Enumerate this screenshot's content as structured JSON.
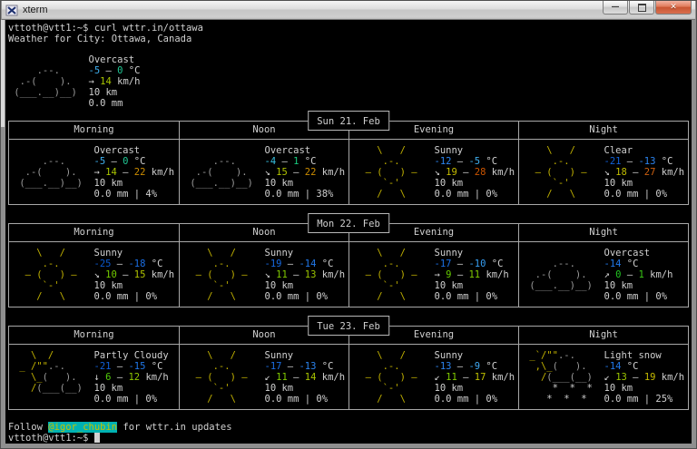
{
  "window": {
    "title": "xterm",
    "controls": {
      "minimize": "minimize-icon",
      "maximize": "maximize-icon",
      "close": "close-icon"
    }
  },
  "colors": {
    "fg": "#d0d0d0",
    "y": "#c2b200",
    "c": "#9a9a9a",
    "w": "#d0d0d0",
    "border": "#a8a8a8",
    "handle_bg": "#00b2b2",
    "handle_fg": "#c3c300"
  },
  "terminal": {
    "command_line": "vttoth@vtt1:~$ curl wttr.in/ottawa",
    "location_line": "Weather for City: Ottawa, Canada",
    "footer_prefix": "Follow ",
    "footer_handle": "@igor_chubin",
    "footer_suffix": " for wttr.in updates",
    "prompt": "vttoth@vtt1:~$ "
  },
  "current": {
    "condition": "Overcast",
    "icon": "overcast",
    "temp": [
      {
        "t": "-5",
        "c": "#3fb0f0"
      },
      {
        "t": " – "
      },
      {
        "t": "0",
        "c": "#20c895"
      },
      {
        "t": " °C"
      }
    ],
    "wind": [
      {
        "t": "→ "
      },
      {
        "t": "14",
        "c": "#a8c400"
      },
      {
        "t": " km/h"
      }
    ],
    "visibility": "10 km",
    "precip": "0.0 mm"
  },
  "days": [
    {
      "date": "Sun 21. Feb",
      "periods": [
        {
          "label": "Morning",
          "icon": "overcast",
          "condition": "Overcast",
          "temp": [
            {
              "t": "-5",
              "c": "#3fb0f0"
            },
            {
              "t": " – "
            },
            {
              "t": "0",
              "c": "#20c895"
            },
            {
              "t": " °C"
            }
          ],
          "wind": [
            {
              "t": "→ "
            },
            {
              "t": "14",
              "c": "#a8c400"
            },
            {
              "t": " – "
            },
            {
              "t": "22",
              "c": "#cc8c00"
            },
            {
              "t": " km/h"
            }
          ],
          "visibility": "10 km",
          "precip": "0.0 mm | 4%"
        },
        {
          "label": "Noon",
          "icon": "overcast",
          "condition": "Overcast",
          "temp": [
            {
              "t": "-4",
              "c": "#38c0e0"
            },
            {
              "t": " – "
            },
            {
              "t": "1",
              "c": "#18cc80"
            },
            {
              "t": " °C"
            }
          ],
          "wind": [
            {
              "t": "↘ "
            },
            {
              "t": "15",
              "c": "#b0c200"
            },
            {
              "t": " – "
            },
            {
              "t": "22",
              "c": "#cc8c00"
            },
            {
              "t": " km/h"
            }
          ],
          "visibility": "10 km",
          "precip": "0.0 mm | 38%"
        },
        {
          "label": "Evening",
          "icon": "sunny",
          "condition": "Sunny",
          "temp": [
            {
              "t": "-12",
              "c": "#2b84f0"
            },
            {
              "t": " – "
            },
            {
              "t": "-5",
              "c": "#3fb0f0"
            },
            {
              "t": " °C"
            }
          ],
          "wind": [
            {
              "t": "↘ "
            },
            {
              "t": "19",
              "c": "#c4ba00"
            },
            {
              "t": " – "
            },
            {
              "t": "28",
              "c": "#cc5500"
            },
            {
              "t": " km/h"
            }
          ],
          "visibility": "10 km",
          "precip": "0.0 mm | 0%"
        },
        {
          "label": "Night",
          "icon": "sunny",
          "condition": "Clear",
          "temp": [
            {
              "t": "-21",
              "c": "#1061da"
            },
            {
              "t": " – "
            },
            {
              "t": "-13",
              "c": "#2b84f0"
            },
            {
              "t": " °C"
            }
          ],
          "wind": [
            {
              "t": "↘ "
            },
            {
              "t": "18",
              "c": "#c0bc00"
            },
            {
              "t": " – "
            },
            {
              "t": "27",
              "c": "#cc6010"
            },
            {
              "t": " km/h"
            }
          ],
          "visibility": "10 km",
          "precip": "0.0 mm | 0%"
        }
      ]
    },
    {
      "date": "Mon 22. Feb",
      "periods": [
        {
          "label": "Morning",
          "icon": "sunny",
          "condition": "Sunny",
          "temp": [
            {
              "t": "-25",
              "c": "#0a58d0"
            },
            {
              "t": " – "
            },
            {
              "t": "-18",
              "c": "#1a6ee4"
            },
            {
              "t": " °C"
            }
          ],
          "wind": [
            {
              "t": "↘ "
            },
            {
              "t": "10",
              "c": "#74cc00"
            },
            {
              "t": " – "
            },
            {
              "t": "15",
              "c": "#b0c200"
            },
            {
              "t": " km/h"
            }
          ],
          "visibility": "10 km",
          "precip": "0.0 mm | 0%"
        },
        {
          "label": "Noon",
          "icon": "sunny",
          "condition": "Sunny",
          "temp": [
            {
              "t": "-19",
              "c": "#1668e0"
            },
            {
              "t": " – "
            },
            {
              "t": "-14",
              "c": "#2078ea"
            },
            {
              "t": " °C"
            }
          ],
          "wind": [
            {
              "t": "↘ "
            },
            {
              "t": "11",
              "c": "#80ca00"
            },
            {
              "t": " – "
            },
            {
              "t": "13",
              "c": "#9cc600"
            },
            {
              "t": " km/h"
            }
          ],
          "visibility": "10 km",
          "precip": "0.0 mm | 0%"
        },
        {
          "label": "Evening",
          "icon": "sunny",
          "condition": "Sunny",
          "temp": [
            {
              "t": "-17",
              "c": "#1a6ee4"
            },
            {
              "t": " – "
            },
            {
              "t": "-10",
              "c": "#37a0f5"
            },
            {
              "t": " °C"
            }
          ],
          "wind": [
            {
              "t": "→ "
            },
            {
              "t": "9",
              "c": "#66ce00"
            },
            {
              "t": " – "
            },
            {
              "t": "11",
              "c": "#80ca00"
            },
            {
              "t": " km/h"
            }
          ],
          "visibility": "10 km",
          "precip": "0.0 mm | 0%"
        },
        {
          "label": "Night",
          "icon": "overcast",
          "condition": "Overcast",
          "temp": [
            {
              "t": "-14",
              "c": "#2078ea"
            },
            {
              "t": " °C"
            }
          ],
          "wind": [
            {
              "t": "↗ "
            },
            {
              "t": "0",
              "c": "#22c822"
            },
            {
              "t": " – "
            },
            {
              "t": "1",
              "c": "#3aca16"
            },
            {
              "t": " km/h"
            }
          ],
          "visibility": "10 km",
          "precip": "0.0 mm | 0%"
        }
      ]
    },
    {
      "date": "Tue 23. Feb",
      "periods": [
        {
          "label": "Morning",
          "icon": "partly",
          "condition": "Partly Cloudy",
          "temp": [
            {
              "t": "-21",
              "c": "#1061da"
            },
            {
              "t": " – "
            },
            {
              "t": "-15",
              "c": "#2078ea"
            },
            {
              "t": " °C"
            }
          ],
          "wind": [
            {
              "t": "↓ "
            },
            {
              "t": "6",
              "c": "#52cc0a"
            },
            {
              "t": " – "
            },
            {
              "t": "12",
              "c": "#90c800"
            },
            {
              "t": " km/h"
            }
          ],
          "visibility": "10 km",
          "precip": "0.0 mm | 0%"
        },
        {
          "label": "Noon",
          "icon": "sunny",
          "condition": "Sunny",
          "temp": [
            {
              "t": "-17",
              "c": "#1a6ee4"
            },
            {
              "t": " – "
            },
            {
              "t": "-13",
              "c": "#2b84f0"
            },
            {
              "t": " °C"
            }
          ],
          "wind": [
            {
              "t": "↙ "
            },
            {
              "t": "11",
              "c": "#80ca00"
            },
            {
              "t": " – "
            },
            {
              "t": "14",
              "c": "#a8c400"
            },
            {
              "t": " km/h"
            }
          ],
          "visibility": "10 km",
          "precip": "0.0 mm | 0%"
        },
        {
          "label": "Evening",
          "icon": "sunny",
          "condition": "Sunny",
          "temp": [
            {
              "t": "-13",
              "c": "#2b84f0"
            },
            {
              "t": " – "
            },
            {
              "t": "-9",
              "c": "#3fa8f2"
            },
            {
              "t": " °C"
            }
          ],
          "wind": [
            {
              "t": "↙ "
            },
            {
              "t": "11",
              "c": "#80ca00"
            },
            {
              "t": " – "
            },
            {
              "t": "17",
              "c": "#bcbe00"
            },
            {
              "t": " km/h"
            }
          ],
          "visibility": "10 km",
          "precip": "0.0 mm | 0%"
        },
        {
          "label": "Night",
          "icon": "lightsnow",
          "condition": "Light snow",
          "temp": [
            {
              "t": "-14",
              "c": "#2078ea"
            },
            {
              "t": " °C"
            }
          ],
          "wind": [
            {
              "t": "↙ "
            },
            {
              "t": "13",
              "c": "#9cc600"
            },
            {
              "t": " – "
            },
            {
              "t": "19",
              "c": "#c4ba00"
            },
            {
              "t": " km/h"
            }
          ],
          "visibility": "10 km",
          "precip": "0.0 mm | 25%"
        }
      ]
    }
  ],
  "icons": {
    "sunny": [
      [
        {
          "t": "    \\   /    ",
          "c": "y"
        }
      ],
      [
        {
          "t": "     .-.     ",
          "c": "y"
        }
      ],
      [
        {
          "t": "  – (   ) –  ",
          "c": "y"
        }
      ],
      [
        {
          "t": "     `-'     ",
          "c": "y"
        }
      ],
      [
        {
          "t": "    /   \\    ",
          "c": "y"
        }
      ]
    ],
    "overcast": [
      [
        {
          "t": "             "
        }
      ],
      [
        {
          "t": "     .--.    ",
          "c": "c"
        }
      ],
      [
        {
          "t": "  .-(    ).  ",
          "c": "c"
        }
      ],
      [
        {
          "t": " (___.__)__) ",
          "c": "c"
        }
      ],
      [
        {
          "t": "             "
        }
      ]
    ],
    "partly": [
      [
        {
          "t": "   \\  /      ",
          "c": "y"
        }
      ],
      [
        {
          "t": " _ /\"\"",
          "c": "y"
        },
        {
          "t": ".-.    ",
          "c": "c"
        }
      ],
      [
        {
          "t": "   \\_",
          "c": "y"
        },
        {
          "t": "(   ).  ",
          "c": "c"
        }
      ],
      [
        {
          "t": "   /",
          "c": "y"
        },
        {
          "t": "(___(__) ",
          "c": "c"
        }
      ],
      [
        {
          "t": "             "
        }
      ]
    ],
    "lightsnow": [
      [
        {
          "t": " _`/\"\"",
          "c": "y"
        },
        {
          "t": ".-.    ",
          "c": "c"
        }
      ],
      [
        {
          "t": "  ,\\_",
          "c": "y"
        },
        {
          "t": "(   ).  ",
          "c": "c"
        }
      ],
      [
        {
          "t": "   /",
          "c": "y"
        },
        {
          "t": "(___(__) ",
          "c": "c"
        }
      ],
      [
        {
          "t": "     *  *  * ",
          "c": "w"
        }
      ],
      [
        {
          "t": "    *  *  *  ",
          "c": "w"
        }
      ]
    ]
  }
}
